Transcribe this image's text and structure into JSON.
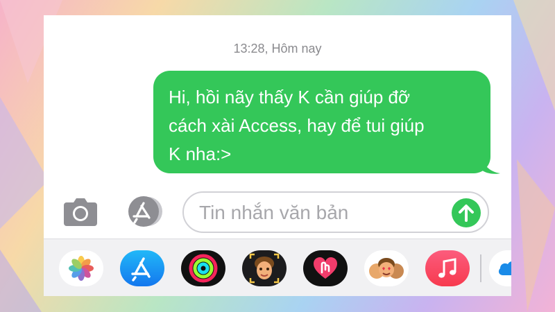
{
  "conversation": {
    "timestamp": "13:28, Hôm nay",
    "messages": [
      {
        "direction": "outgoing",
        "lines": [
          "Hi, hồi nãy thấy K cần giúp đỡ",
          "cách xài Access, hay để tui giúp",
          "K nha:>"
        ]
      }
    ]
  },
  "composer": {
    "placeholder": "Tin nhắn văn bản",
    "value": ""
  },
  "app_drawer": {
    "apps": [
      "photos-icon",
      "app-store-icon",
      "activity-icon",
      "memoji-icon",
      "digital-touch-icon",
      "memoji-stickers-icon",
      "music-icon",
      "cloud-icon"
    ]
  },
  "colors": {
    "bubble": "#34c759",
    "send_button": "#34c759",
    "icon_gray": "#8e8e93",
    "timestamp": "#8a8a8e"
  }
}
